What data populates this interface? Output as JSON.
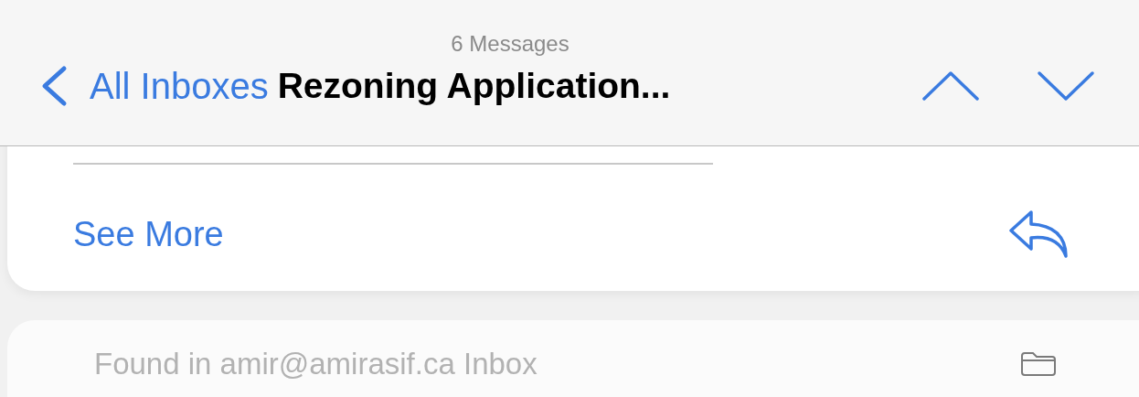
{
  "nav": {
    "back_label": "All Inboxes",
    "subtitle": "6 Messages",
    "title": "Rezoning Application..."
  },
  "message": {
    "see_more": "See More"
  },
  "found_in": {
    "text": "Found in amir@amirasif.ca Inbox"
  }
}
